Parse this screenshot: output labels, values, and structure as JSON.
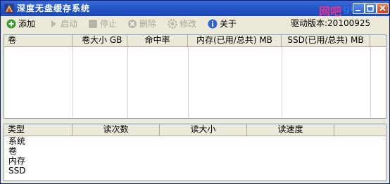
{
  "window": {
    "title": "深度无盘缓存系统",
    "watermark_main": "网吧",
    "watermark_sub": "ge-sj"
  },
  "toolbar": {
    "items": [
      {
        "label": "添加",
        "icon": "plus-circle-icon",
        "enabled": true
      },
      {
        "label": "启动",
        "icon": "play-icon",
        "enabled": false
      },
      {
        "label": "停止",
        "icon": "stop-icon",
        "enabled": false
      },
      {
        "label": "删除",
        "icon": "delete-icon",
        "enabled": false
      },
      {
        "label": "修改",
        "icon": "gear-icon",
        "enabled": false
      },
      {
        "label": "关于",
        "icon": "info-icon",
        "enabled": true
      }
    ],
    "driver_version": "驱动版本:20100925"
  },
  "disk_table": {
    "columns": [
      "卷",
      "卷大小 GB",
      "命中率",
      "内存(已用/总共) MB",
      "SSD(已用/总共) MB"
    ],
    "rows": []
  },
  "stats_table": {
    "columns": [
      "类型",
      "读次数",
      "读大小",
      "读速度"
    ],
    "rows": [
      "系统",
      "卷",
      "内存",
      "SSD"
    ]
  },
  "colors": {
    "titlebar": "#2457c7",
    "panel_border": "#7f9db9",
    "chrome": "#ece9d8",
    "disabled_text": "#a6a598"
  }
}
